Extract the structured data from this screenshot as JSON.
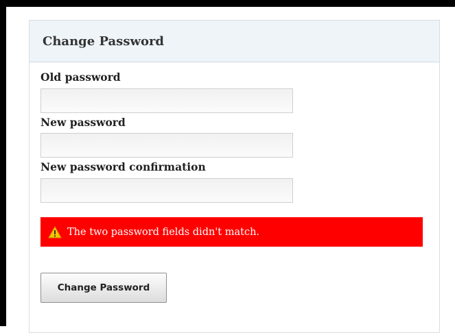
{
  "form": {
    "title": "Change Password",
    "fields": [
      {
        "label": "Old password",
        "value": ""
      },
      {
        "label": "New password",
        "value": ""
      },
      {
        "label": "New password confirmation",
        "value": ""
      }
    ],
    "error": {
      "icon": "warning-icon",
      "message": "The two password fields didn't match.",
      "color": "#ff0000"
    },
    "submit_label": "Change Password"
  }
}
